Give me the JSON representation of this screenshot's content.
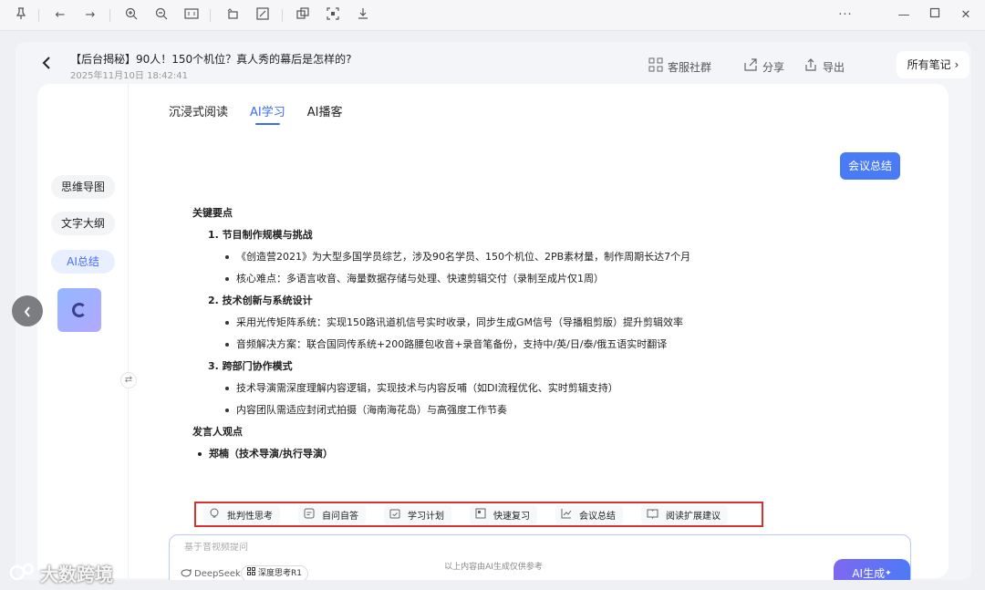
{
  "header": {
    "title": "【后台揭秘】90人！150个机位？真人秀的幕后是怎样的?",
    "date": "2025年11月10日 18:42:41",
    "actions": [
      {
        "label": "客服社群",
        "icon": "qr-grid-icon"
      },
      {
        "label": "分享",
        "icon": "share-icon"
      },
      {
        "label": "导出",
        "icon": "export-icon"
      }
    ],
    "all_notes": "所有笔记"
  },
  "sidebar": {
    "items": [
      {
        "label": "思维导图"
      },
      {
        "label": "文字大纲"
      },
      {
        "label": "AI总结"
      }
    ]
  },
  "tabs": [
    {
      "label": "沉浸式阅读"
    },
    {
      "label": "AI学习"
    },
    {
      "label": "AI播客"
    }
  ],
  "meeting_button": "会议总结",
  "summary": {
    "key_points_heading": "关键要点",
    "sections": [
      {
        "title": "1. 节目制作规模与挑战",
        "bullets": [
          "《创造营2021》为大型多国学员综艺，涉及90名学员、150个机位、2PB素材量，制作周期长达7个月",
          "核心难点：多语言收音、海量数据存储与处理、快速剪辑交付（录制至成片仅1周）"
        ]
      },
      {
        "title": "2. 技术创新与系统设计",
        "bullets": [
          "采用光传矩阵系统：实现150路讯道机信号实时收录，同步生成GM信号（导播粗剪版）提升剪辑效率",
          "音频解决方案：联合国同传系统+200路腰包收音+录音笔备份，支持中/英/日/泰/俄五语实时翻译"
        ]
      },
      {
        "title": "3. 跨部门协作模式",
        "bullets": [
          "技术导演需深度理解内容逻辑，实现技术与内容反哺（如DI流程优化、实时剪辑支持）",
          "内容团队需适应封闭式拍摄（海南海花岛）与高强度工作节奏"
        ]
      }
    ],
    "speaker_heading": "发言人观点",
    "speaker": "郑楠（技术导演/执行导演）"
  },
  "quick_actions": [
    {
      "label": "批判性思考",
      "icon": "bulb-icon"
    },
    {
      "label": "自问自答",
      "icon": "qa-icon"
    },
    {
      "label": "学习计划",
      "icon": "calendar-icon"
    },
    {
      "label": "快速复习",
      "icon": "review-icon"
    },
    {
      "label": "会议总结",
      "icon": "chart-icon"
    },
    {
      "label": "阅读扩展建议",
      "icon": "book-icon"
    }
  ],
  "ask": {
    "placeholder": "基于音视频提问",
    "model": "DeepSeek",
    "deep_think": "深度思考R1",
    "generate": "AI生成"
  },
  "footer_note": "以上内容由AI生成仅供参考",
  "watermark": "大数跨境"
}
